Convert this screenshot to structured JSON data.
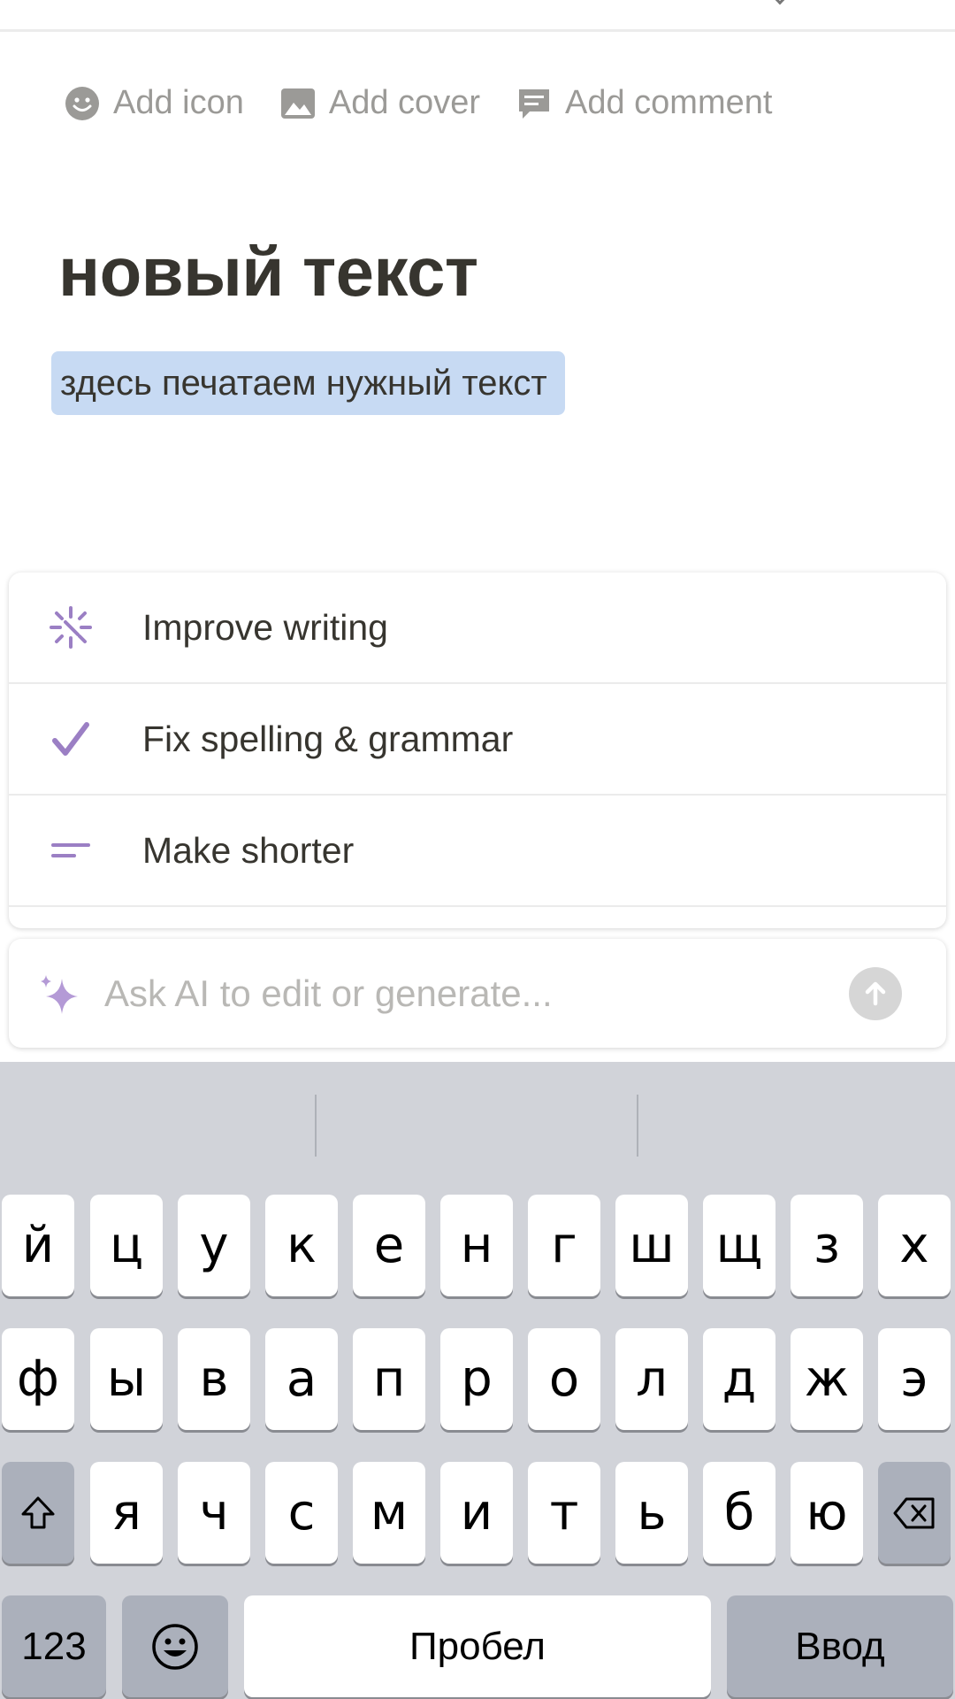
{
  "page_actions": {
    "add_icon": "Add icon",
    "add_cover": "Add cover",
    "add_comment": "Add comment"
  },
  "page": {
    "title": "новый текст",
    "selected_text": "здесь печатаем нужный текст"
  },
  "ai_menu": {
    "items": [
      {
        "label": "Improve writing",
        "icon": "sparkle-burst-icon"
      },
      {
        "label": "Fix spelling & grammar",
        "icon": "checkmark-icon"
      },
      {
        "label": "Make shorter",
        "icon": "short-lines-icon"
      }
    ],
    "input_placeholder": "Ask AI to edit or generate...",
    "accent_color": "#9b7fc4"
  },
  "keyboard": {
    "row1": [
      "й",
      "ц",
      "у",
      "к",
      "е",
      "н",
      "г",
      "ш",
      "щ",
      "з",
      "х"
    ],
    "row2": [
      "ф",
      "ы",
      "в",
      "а",
      "п",
      "р",
      "о",
      "л",
      "д",
      "ж",
      "э"
    ],
    "row3": [
      "я",
      "ч",
      "с",
      "м",
      "и",
      "т",
      "ь",
      "б",
      "ю"
    ],
    "numbers_key": "123",
    "space_key": "Пробел",
    "return_key": "Ввод"
  }
}
